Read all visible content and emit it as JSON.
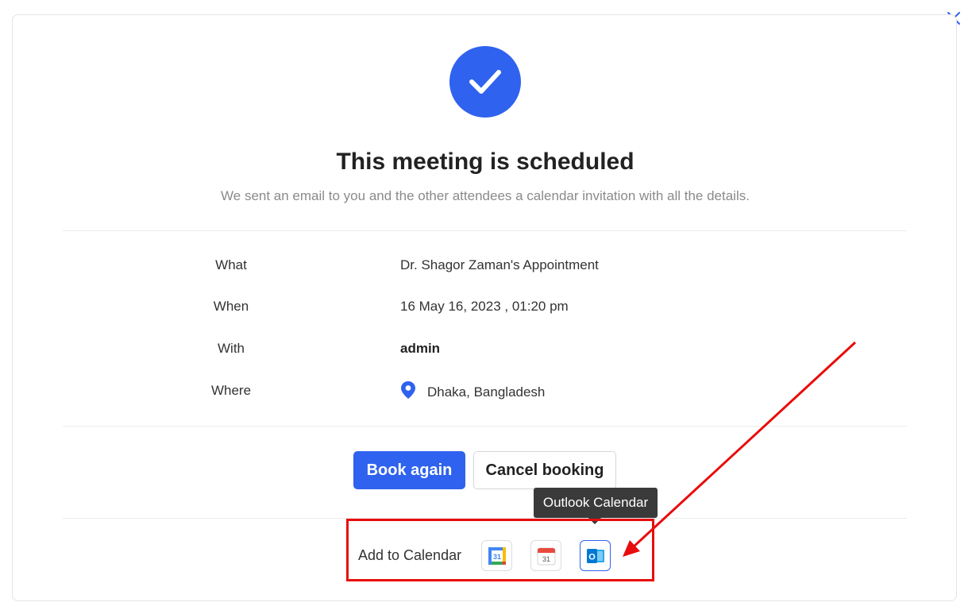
{
  "dialog": {
    "title": "This meeting is scheduled",
    "subtitle": "We sent an email to you and the other attendees a calendar invitation with all the details."
  },
  "details": {
    "what_label": "What",
    "what_value": "Dr. Shagor Zaman's Appointment",
    "when_label": "When",
    "when_value": "16 May 16, 2023 , 01:20 pm",
    "with_label": "With",
    "with_value": "admin",
    "where_label": "Where",
    "where_value": "Dhaka, Bangladesh"
  },
  "actions": {
    "book_again": "Book again",
    "cancel_booking": "Cancel booking"
  },
  "calendar": {
    "add_label": "Add to Calendar",
    "tooltip": "Outlook Calendar",
    "google_icon_text": "31",
    "apple_icon_text": "31",
    "outlook_icon_text": "O"
  },
  "colors": {
    "accent": "#2f62ee",
    "annotation": "#e80d0d",
    "tooltip_bg": "#3a3a3a"
  },
  "icons": [
    "close-icon",
    "check-icon",
    "location-pin-icon",
    "google-calendar-icon",
    "apple-calendar-icon",
    "outlook-calendar-icon"
  ]
}
